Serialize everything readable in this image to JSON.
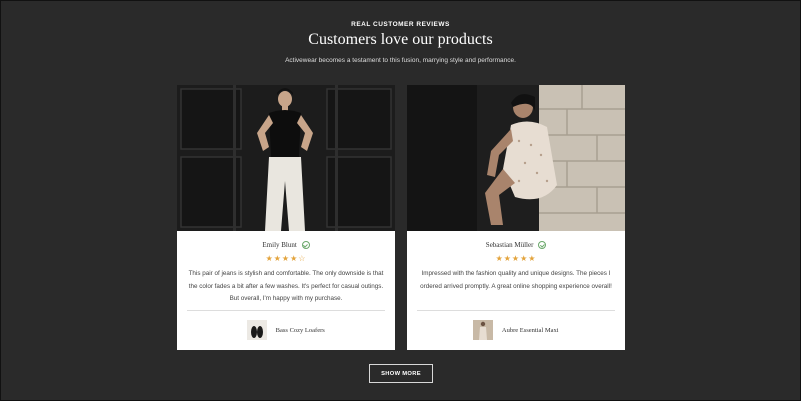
{
  "section": {
    "eyebrow": "REAL CUSTOMER REVIEWS",
    "title": "Customers love our products",
    "subtitle": "Activewear becomes a testament to this fusion, marrying style and performance."
  },
  "reviews": [
    {
      "name": "Emily Blunt",
      "verified_icon": "check-circle-icon",
      "rating": 4,
      "rating_max": 5,
      "stars": "★★★★",
      "stars_empty": "☆",
      "text": "This pair of jeans is stylish and comfortable. The only downside is that the color fades a bit after a few washes. It's perfect for casual outings. But overall, I'm happy with my purchase.",
      "product": "Bass Cozy Loafers"
    },
    {
      "name": "Sebastian Müller",
      "verified_icon": "check-circle-icon",
      "rating": 5,
      "rating_max": 5,
      "stars": "★★★★★",
      "stars_empty": "",
      "text": "Impressed with the fashion quality and unique designs. The pieces I ordered arrived promptly. A great online shopping experience overall!",
      "product": "Aubre Essential Maxi"
    }
  ],
  "actions": {
    "show_more": "SHOW MORE"
  },
  "colors": {
    "background": "#2a2a2a",
    "star": "#e3a33b",
    "verified": "#6aa86a"
  }
}
